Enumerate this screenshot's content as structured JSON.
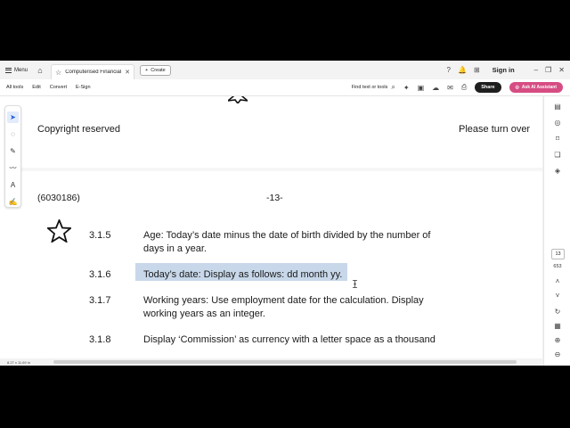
{
  "tabbar": {
    "menu_label": "Menu",
    "tab_title": "Computerised Financial...",
    "create_label": "Create",
    "signin_label": "Sign in"
  },
  "toolbar": {
    "items": [
      "All tools",
      "Edit",
      "Convert",
      "E-Sign"
    ],
    "find_label": "Find text or tools",
    "share_label": "Share",
    "ai_label": "Ask AI Assistant"
  },
  "document": {
    "page1": {
      "left_footer": "Copyright reserved",
      "right_footer": "Please turn over"
    },
    "page2": {
      "code": "(6030186)",
      "page_number": "-13-",
      "items": [
        {
          "num": "3.1.5",
          "line1": "Age:  Today’s date minus the date of birth divided by the number of",
          "line2": "days in a year."
        },
        {
          "num": "3.1.6",
          "line1": "Today’s date:  Display as follows:  dd month yy.",
          "line2": ""
        },
        {
          "num": "3.1.7",
          "line1": "Working years: Use employment date for the calculation. Display",
          "line2": "working years as an integer."
        },
        {
          "num": "3.1.8",
          "line1": "Display ‘Commission’ as currency with a letter space as a thousand",
          "line2": ""
        }
      ]
    }
  },
  "sidebar_right": {
    "current_page": "13",
    "page_count": "653"
  },
  "status": {
    "page_size": "8.27 x 11.69 in"
  },
  "colors": {
    "highlight": "#c8d8ea",
    "ai_button": "#d64d83",
    "share_button": "#1f1f1f",
    "active_tool": "#1e5bd6"
  }
}
